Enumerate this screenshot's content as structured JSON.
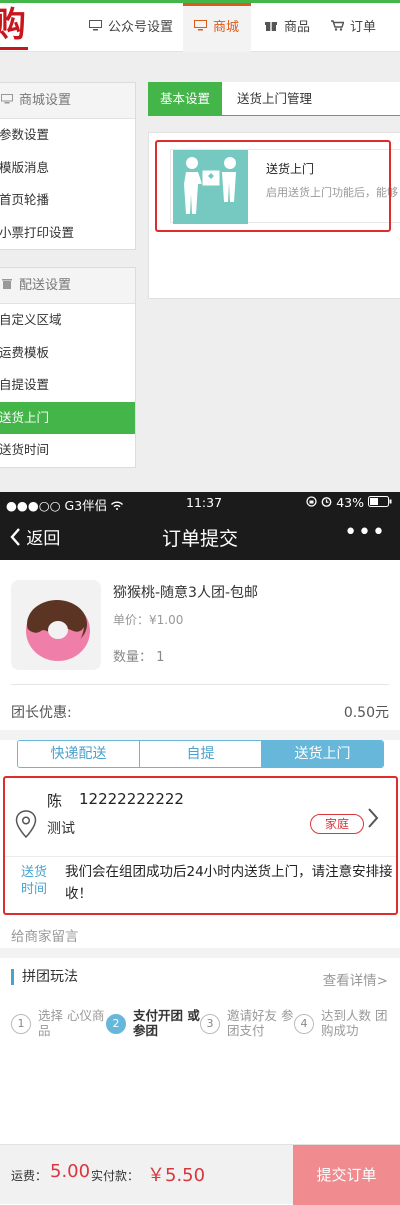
{
  "admin": {
    "logo_text": "购",
    "nav": [
      "公众号设置",
      "商城",
      "商品",
      "订单"
    ],
    "shop_settings": {
      "title": "商城设置",
      "items": [
        "参数设置",
        "模版消息",
        "首页轮播",
        "小票打印设置"
      ]
    },
    "delivery_settings": {
      "title": "配送设置",
      "items": [
        "自定义区域",
        "运费模板",
        "自提设置",
        "送货上门",
        "送货时间"
      ]
    },
    "tabs": [
      "基本设置",
      "送货上门管理"
    ],
    "plugin": {
      "title": "送货上门",
      "desc": "启用送货上门功能后，能够"
    }
  },
  "phone": {
    "status": {
      "carrier": "●●●○○ G3伴侣",
      "time": "11:37",
      "battery": "43%"
    },
    "nav": {
      "back": "返回",
      "title": "订单提交",
      "more": "•••"
    },
    "product": {
      "name": "猕猴桃-随意3人团-包邮",
      "price": "单价：¥1.00",
      "qty": "数量：  1"
    },
    "discount": {
      "label": "团长优惠:",
      "value": "0.50元"
    },
    "delivery_tabs": [
      "快递配送",
      "自提",
      "送货上门"
    ],
    "address": {
      "name": "陈",
      "phone": "12222222222",
      "detail": "测试",
      "tag": "家庭"
    },
    "delivery_time": {
      "label": "送货时间",
      "text": "我们会在组团成功后24小时内送货上门，请注意安排接收！"
    },
    "remark_placeholder": "给商家留言",
    "group": {
      "title": "拼团玩法",
      "more": "查看详情>",
      "steps": [
        {
          "num": "1",
          "text": "选择 心仪商品"
        },
        {
          "num": "2",
          "text": "支付开团 或参团"
        },
        {
          "num": "3",
          "text": "邀请好友 参团支付"
        },
        {
          "num": "4",
          "text": "达到人数 团购成功"
        }
      ]
    },
    "footer": {
      "shipping_label": "运费：",
      "shipping_value": "5.00",
      "paid_label": "实付款：",
      "paid_value": "￥5.50",
      "submit": "提交订单"
    }
  }
}
